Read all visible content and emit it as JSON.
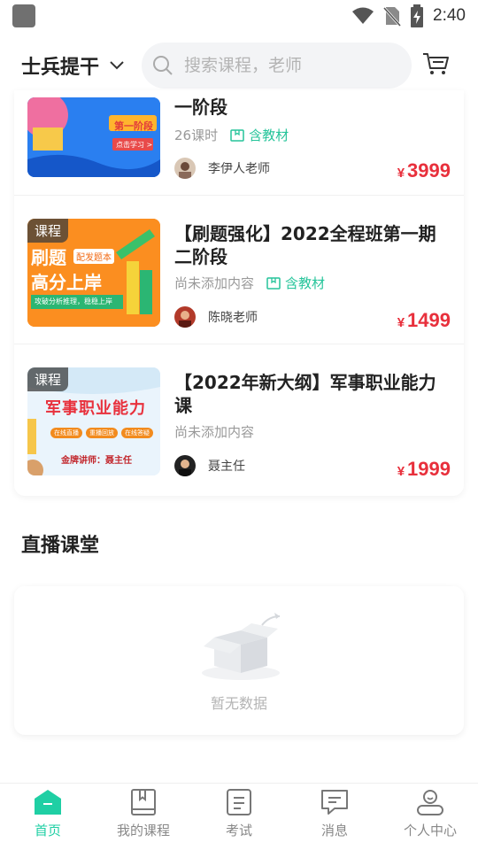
{
  "status_bar": {
    "time": "2:40"
  },
  "header": {
    "region": "士兵提干",
    "search_placeholder": "搜索课程，老师"
  },
  "courses": [
    {
      "title_line2": "一阶段",
      "meta": "26课时",
      "tag": "含教材",
      "teacher": "李伊人老师",
      "currency": "¥",
      "price": "3999",
      "thumb_text": {
        "banner": "第一阶段",
        "button": "点击学习 >"
      }
    },
    {
      "badge": "课程",
      "title": "【刷题强化】2022全程班第一期二阶段",
      "meta": "尚未添加内容",
      "tag": "含教材",
      "teacher": "陈晓老师",
      "currency": "¥",
      "price": "1499",
      "thumb_text": {
        "line1": "刷题",
        "stamp": "配发题本",
        "line2": "高分上岸",
        "sub": "攻破分析推理，稳稳上岸"
      }
    },
    {
      "badge": "课程",
      "title": "【2022年新大纲】军事职业能力课",
      "meta": "尚未添加内容",
      "teacher": "聂主任",
      "currency": "¥",
      "price": "1999",
      "thumb_text": {
        "line1": "军事职业能力",
        "chips": [
          "在线直播",
          "重播回放",
          "在线答疑"
        ],
        "lecturer": "金牌讲师：聂主任"
      }
    }
  ],
  "live": {
    "title": "直播课堂",
    "empty_text": "暂无数据"
  },
  "nav": {
    "items": [
      {
        "label": "首页",
        "icon": "home-icon",
        "active": true
      },
      {
        "label": "我的课程",
        "icon": "book-icon",
        "active": false
      },
      {
        "label": "考试",
        "icon": "exam-icon",
        "active": false
      },
      {
        "label": "消息",
        "icon": "message-icon",
        "active": false
      },
      {
        "label": "个人中心",
        "icon": "profile-icon",
        "active": false
      }
    ]
  },
  "colors": {
    "accent": "#1fcfa4",
    "price": "#e8303c",
    "tag": "#25c49a"
  }
}
